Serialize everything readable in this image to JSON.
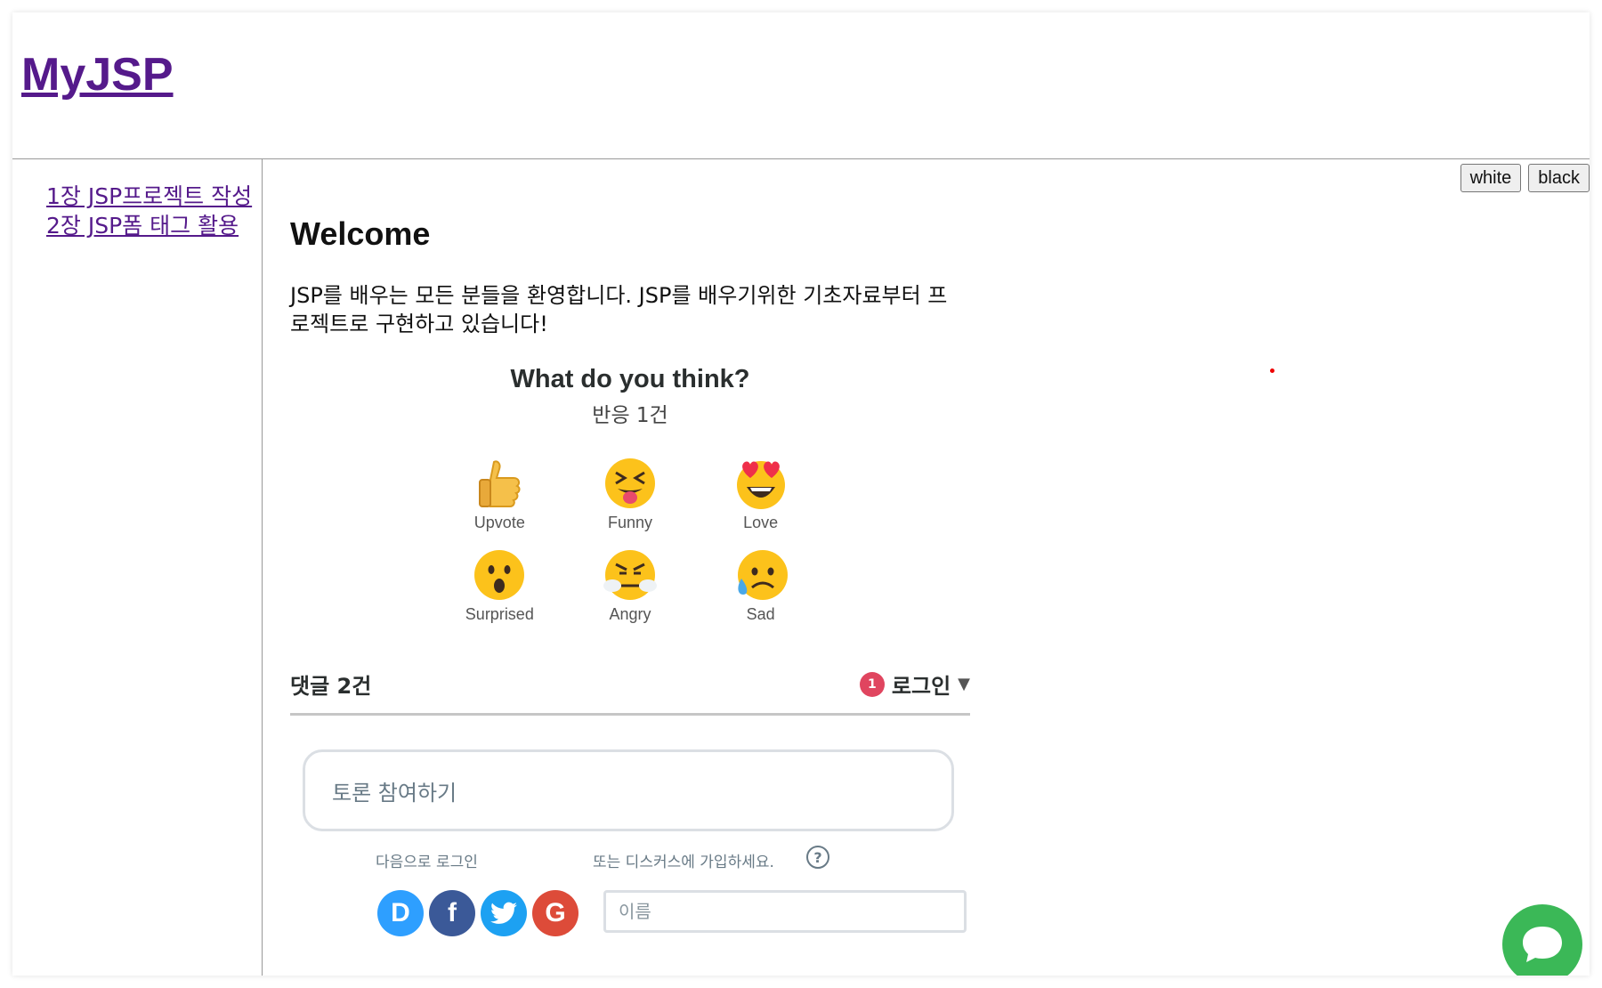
{
  "site": {
    "title": "MyJSP"
  },
  "sidebar": {
    "items": [
      {
        "label": "1장 JSP프로젝트 작성"
      },
      {
        "label": "2장 JSP폼 태그 활용"
      }
    ]
  },
  "theme_buttons": {
    "white": "white",
    "black": "black"
  },
  "main": {
    "heading": "Welcome",
    "intro": "JSP를 배우는 모든 분들을 환영합니다. JSP를 배우기위한 기초자료부터 프로젝트로 구현하고 있습니다!"
  },
  "disqus": {
    "reactions_title": "What do you think?",
    "reactions_count": "반응 1건",
    "reactions": [
      {
        "label": "Upvote",
        "icon": "thumbs-up-icon"
      },
      {
        "label": "Funny",
        "icon": "squinting-tongue-face-icon"
      },
      {
        "label": "Love",
        "icon": "heart-eyes-face-icon"
      },
      {
        "label": "Surprised",
        "icon": "surprised-face-icon"
      },
      {
        "label": "Angry",
        "icon": "angry-steam-face-icon"
      },
      {
        "label": "Sad",
        "icon": "sad-tear-face-icon"
      }
    ],
    "comments_count": "댓글 2건",
    "notification_count": "1",
    "login_label": "로그인",
    "discussion_placeholder": "토론 참여하기",
    "login_with": "다음으로 로그인",
    "or_signup": "또는 디스커스에 가입하세요.",
    "help_symbol": "?",
    "social": {
      "disqus": "D",
      "facebook": "f",
      "google": "G"
    },
    "name_placeholder": "이름"
  },
  "colors": {
    "link": "#551a8b",
    "badge": "#e0455f",
    "chat": "#3bb857"
  }
}
